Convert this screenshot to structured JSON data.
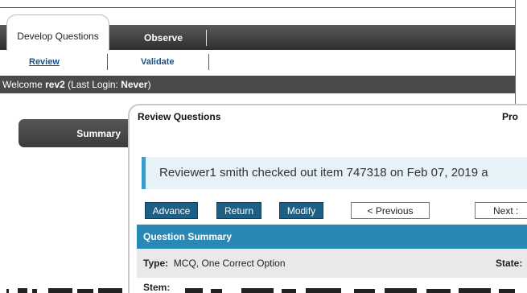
{
  "tabs": {
    "active_label": "Develop Questions",
    "observe_label": "Observe"
  },
  "subnav": {
    "review": "Review",
    "validate": "Validate"
  },
  "welcome": {
    "prefix": "Welcome ",
    "user": "rev2",
    "last_login_prefix": " (Last Login: ",
    "last_login": "Never",
    "suffix": ")"
  },
  "sidebar": {
    "summary_label": "Summary"
  },
  "panel": {
    "title": "Review Questions",
    "right_truncated": "Pro",
    "notice": "Reviewer1 smith checked out item 747318 on Feb 07, 2019 a",
    "buttons": {
      "advance": "Advance",
      "return": "Return",
      "modify": "Modify",
      "previous": "< Previous",
      "next": "Next :"
    },
    "section_header": "Question Summary",
    "type_label": "Type:",
    "type_value": "MCQ, One Correct Option",
    "state_label": "State:",
    "stem_label": "Stem:"
  },
  "colors": {
    "accent": "#2a88b5",
    "dark_button": "#1e5f86",
    "welcome_bar": "#4a4a4a",
    "notice_bg": "#e7f2f8"
  }
}
